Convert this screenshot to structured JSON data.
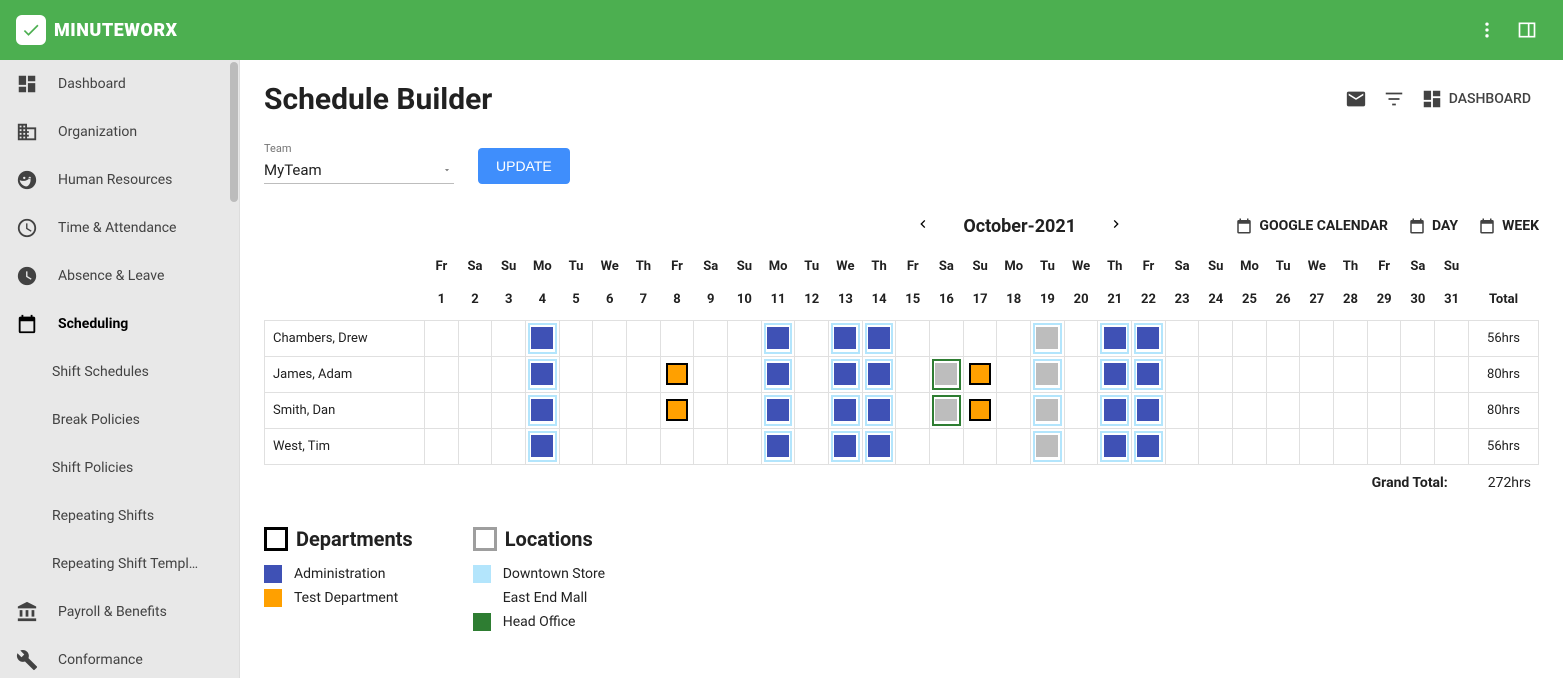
{
  "brand": "MINUTEWORX",
  "sidebar": {
    "items": [
      {
        "label": "Dashboard"
      },
      {
        "label": "Organization"
      },
      {
        "label": "Human Resources"
      },
      {
        "label": "Time & Attendance"
      },
      {
        "label": "Absence & Leave"
      },
      {
        "label": "Scheduling"
      },
      {
        "label": "Payroll & Benefits"
      },
      {
        "label": "Conformance"
      }
    ],
    "sub": [
      {
        "label": "Shift Schedules"
      },
      {
        "label": "Break Policies"
      },
      {
        "label": "Shift Policies"
      },
      {
        "label": "Repeating Shifts"
      },
      {
        "label": "Repeating Shift Templ…"
      }
    ]
  },
  "page": {
    "title": "Schedule Builder",
    "dashboard_btn": "DASHBOARD"
  },
  "controls": {
    "team_label": "Team",
    "team_value": "MyTeam",
    "update_btn": "UPDATE"
  },
  "calendar": {
    "month": "October-2021",
    "google_cal": "GOOGLE CALENDAR",
    "day_btn": "DAY",
    "week_btn": "WEEK",
    "day_abbrs": [
      "Fr",
      "Sa",
      "Su",
      "Mo",
      "Tu",
      "We",
      "Th",
      "Fr",
      "Sa",
      "Su",
      "Mo",
      "Tu",
      "We",
      "Th",
      "Fr",
      "Sa",
      "Su",
      "Mo",
      "Tu",
      "We",
      "Th",
      "Fr",
      "Sa",
      "Su",
      "Mo",
      "Tu",
      "We",
      "Th",
      "Fr",
      "Sa",
      "Su"
    ],
    "day_nums": [
      "1",
      "2",
      "3",
      "4",
      "5",
      "6",
      "7",
      "8",
      "9",
      "10",
      "11",
      "12",
      "13",
      "14",
      "15",
      "16",
      "17",
      "18",
      "19",
      "20",
      "21",
      "22",
      "23",
      "24",
      "25",
      "26",
      "27",
      "28",
      "29",
      "30",
      "31"
    ],
    "total_header": "Total",
    "grand_total_label": "Grand Total:",
    "grand_total_value": "272hrs"
  },
  "rows": [
    {
      "name": "Chambers, Drew",
      "total": "56hrs",
      "cells": {
        "4": {
          "loc": "downtown",
          "dept": "admin"
        },
        "11": {
          "loc": "downtown",
          "dept": "admin"
        },
        "13": {
          "loc": "downtown",
          "dept": "admin"
        },
        "14": {
          "loc": "downtown",
          "dept": "admin"
        },
        "19": {
          "loc": "downtown",
          "dept": "none"
        },
        "21": {
          "loc": "downtown",
          "dept": "admin"
        },
        "22": {
          "loc": "downtown",
          "dept": "admin"
        }
      }
    },
    {
      "name": "James, Adam",
      "total": "80hrs",
      "cells": {
        "4": {
          "loc": "downtown",
          "dept": "admin"
        },
        "8": {
          "loc": "",
          "dept": "test"
        },
        "11": {
          "loc": "downtown",
          "dept": "admin"
        },
        "13": {
          "loc": "downtown",
          "dept": "admin"
        },
        "14": {
          "loc": "downtown",
          "dept": "admin"
        },
        "16": {
          "loc": "head",
          "dept": "none"
        },
        "17": {
          "loc": "",
          "dept": "test"
        },
        "19": {
          "loc": "downtown",
          "dept": "none"
        },
        "21": {
          "loc": "downtown",
          "dept": "admin"
        },
        "22": {
          "loc": "downtown",
          "dept": "admin"
        }
      }
    },
    {
      "name": "Smith, Dan",
      "total": "80hrs",
      "cells": {
        "4": {
          "loc": "downtown",
          "dept": "admin"
        },
        "8": {
          "loc": "",
          "dept": "test"
        },
        "11": {
          "loc": "downtown",
          "dept": "admin"
        },
        "13": {
          "loc": "downtown",
          "dept": "admin"
        },
        "14": {
          "loc": "downtown",
          "dept": "admin"
        },
        "16": {
          "loc": "head",
          "dept": "none"
        },
        "17": {
          "loc": "",
          "dept": "test"
        },
        "19": {
          "loc": "downtown",
          "dept": "none"
        },
        "21": {
          "loc": "downtown",
          "dept": "admin"
        },
        "22": {
          "loc": "downtown",
          "dept": "admin"
        }
      }
    },
    {
      "name": "West, Tim",
      "total": "56hrs",
      "cells": {
        "4": {
          "loc": "downtown",
          "dept": "admin"
        },
        "11": {
          "loc": "downtown",
          "dept": "admin"
        },
        "13": {
          "loc": "downtown",
          "dept": "admin"
        },
        "14": {
          "loc": "downtown",
          "dept": "admin"
        },
        "19": {
          "loc": "downtown",
          "dept": "none"
        },
        "21": {
          "loc": "downtown",
          "dept": "admin"
        },
        "22": {
          "loc": "downtown",
          "dept": "admin"
        }
      }
    }
  ],
  "legend": {
    "dept_header": "Departments",
    "loc_header": "Locations",
    "departments": [
      {
        "key": "admin",
        "label": "Administration"
      },
      {
        "key": "test",
        "label": "Test Department"
      }
    ],
    "locations": [
      {
        "key": "downtown",
        "label": "Downtown Store"
      },
      {
        "key": "eastend",
        "label": "East End Mall"
      },
      {
        "key": "head",
        "label": "Head Office"
      }
    ]
  }
}
